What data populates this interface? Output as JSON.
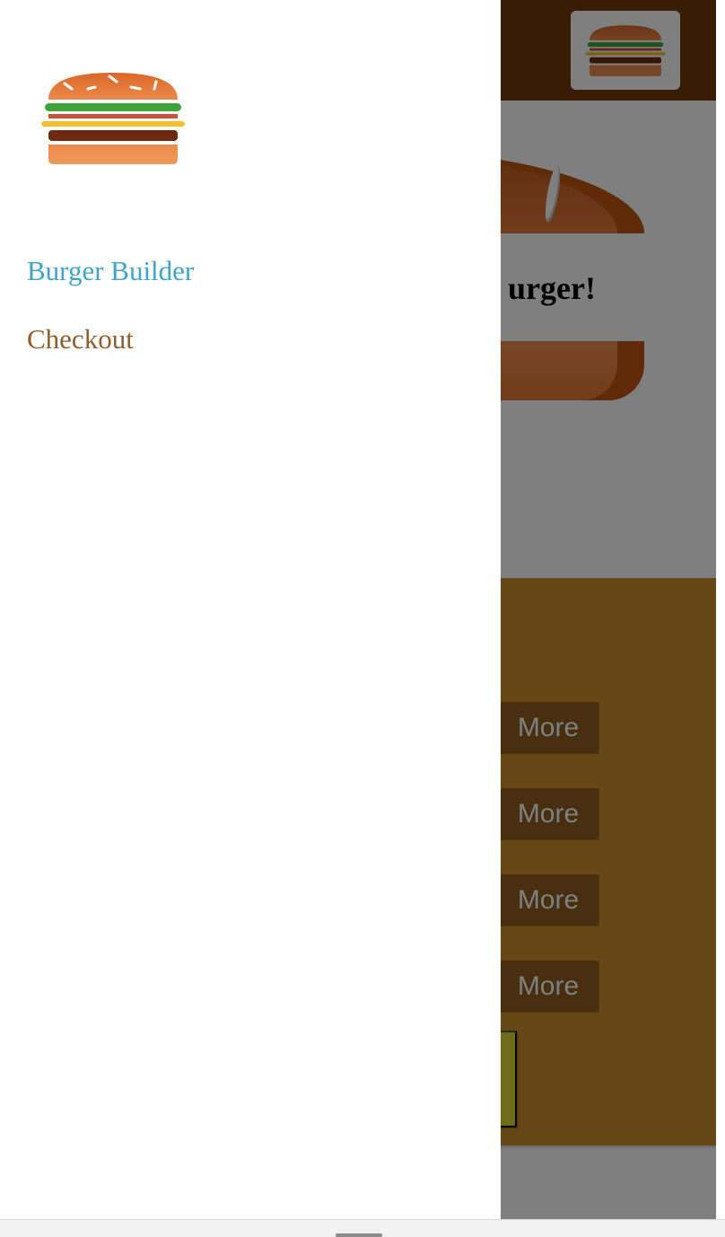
{
  "drawer": {
    "nav_items": [
      {
        "label": "Burger Builder",
        "active": true
      },
      {
        "label": "Checkout",
        "active": false
      }
    ]
  },
  "builder": {
    "start_text": "Please start adding ingredients to your burger!",
    "visible_fragment": "urger!",
    "more_label": "More",
    "controls": [
      {
        "more": "More"
      },
      {
        "more": "More"
      },
      {
        "more": "More"
      },
      {
        "more": "More"
      }
    ]
  },
  "icons": {
    "logo": "burger-logo-icon",
    "toolbar_logo": "burger-logo-icon"
  },
  "colors": {
    "toolbar": "#703b09",
    "controls_bg": "#cf8f2e",
    "nav_active": "#40a4c8",
    "nav_inactive": "#8f5c2c"
  }
}
